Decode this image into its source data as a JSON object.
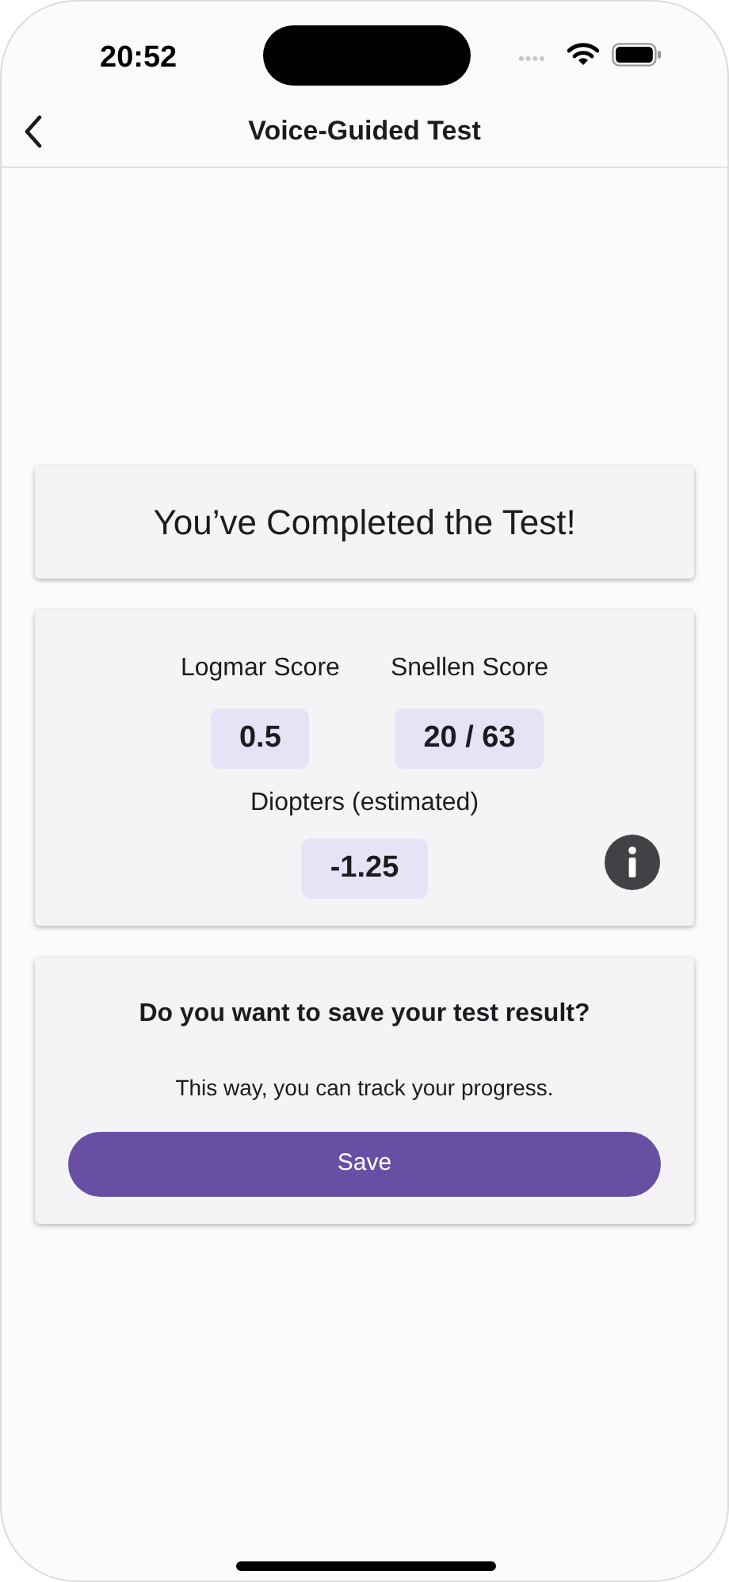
{
  "status_bar": {
    "time": "20:52"
  },
  "nav_bar": {
    "title": "Voice-Guided Test"
  },
  "completion_card": {
    "title": "You’ve Completed the Test!"
  },
  "scores_card": {
    "scores": [
      {
        "label": "Logmar Score",
        "value": "0.5"
      },
      {
        "label": "Snellen Score",
        "value": "20 / 63"
      }
    ],
    "diopters": {
      "label": "Diopters (estimated)",
      "value": "-1.25"
    }
  },
  "save_card": {
    "question": "Do you want to save your test result?",
    "note": "This way, you can track your progress.",
    "button": "Save"
  }
}
